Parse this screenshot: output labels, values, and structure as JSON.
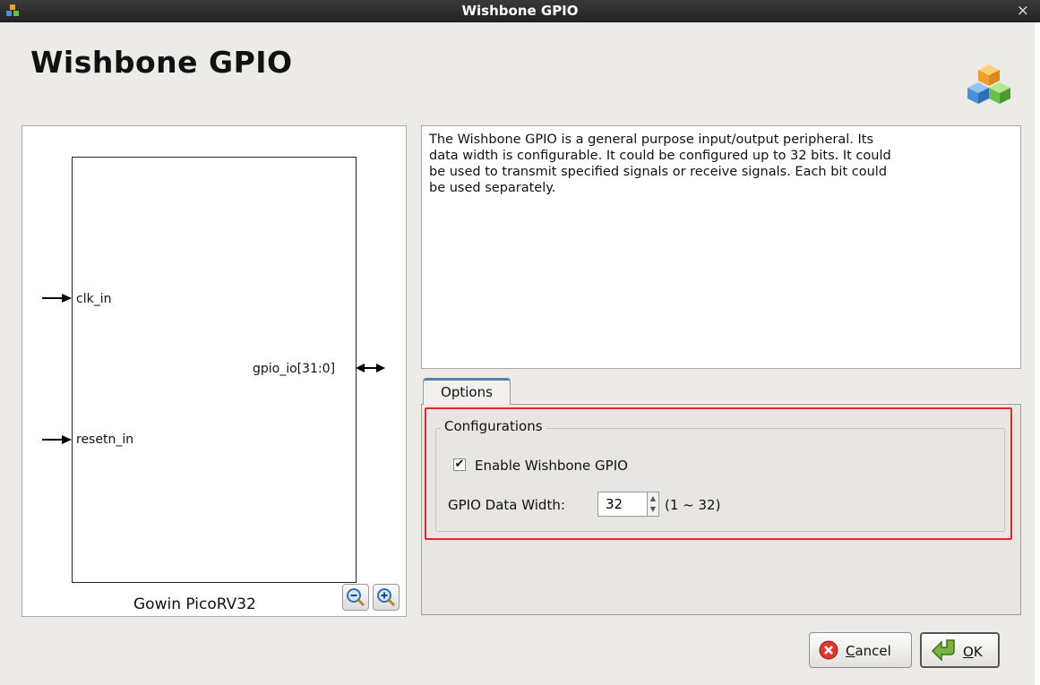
{
  "window": {
    "title": "Wishbone GPIO",
    "close_glyph": "×"
  },
  "header": {
    "title": "Wishbone GPIO",
    "logo_icon": "cubes-icon"
  },
  "diagram": {
    "caption": "Gowin PicoRV32",
    "ports": {
      "clk": "clk_in",
      "reset": "resetn_in",
      "gpio": "gpio_io[31:0]"
    },
    "zoom_out_icon": "zoom-out-icon",
    "zoom_in_icon": "zoom-in-icon"
  },
  "description": "The Wishbone GPIO is a general purpose input/output peripheral. Its\ndata width is configurable. It could be configured up to 32 bits. It could\nbe used to transmit specified signals or receive signals. Each bit could\nbe used separately.",
  "tabs": [
    {
      "label": "Options",
      "selected": true
    }
  ],
  "options": {
    "group_title": "Configurations",
    "enable_label": "Enable Wishbone GPIO",
    "enable_checked": true,
    "check_glyph": "✔",
    "width_label": "GPIO Data Width:",
    "width_value": "32",
    "width_range": "(1 ~ 32)"
  },
  "buttons": {
    "cancel_mnemonic": "C",
    "cancel_rest": "ancel",
    "ok_mnemonic": "O",
    "ok_rest": "K"
  },
  "colors": {
    "highlight": "#e0282d",
    "tab_accent": "#5a7fb0"
  }
}
